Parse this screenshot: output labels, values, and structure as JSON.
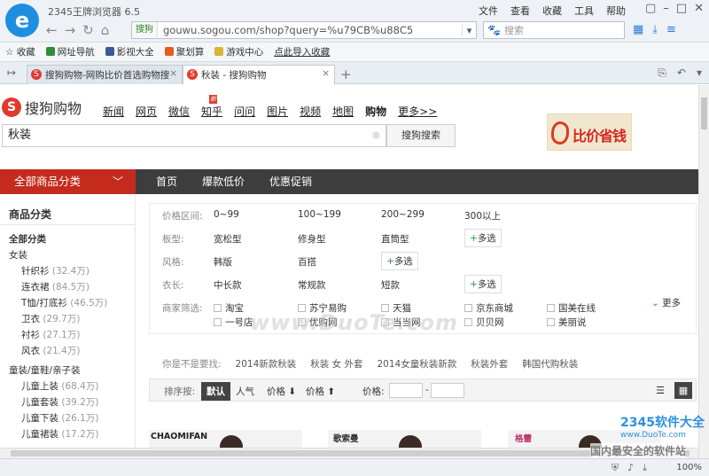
{
  "browser": {
    "title": "2345王牌浏览器 6.5",
    "menu": [
      "文件",
      "查看",
      "收藏",
      "工具",
      "帮助"
    ],
    "address": {
      "safe_label": "搜狗",
      "url": "gouwu.sogou.com/shop?query=%u79CB%u88C5"
    },
    "search_placeholder": "搜索",
    "favorites": [
      "收藏",
      "网址导航",
      "影视大全",
      "聚划算",
      "游戏中心",
      "点此导入收藏"
    ],
    "tabs": [
      {
        "label": "搜狗购物-网购比价首选购物搜"
      },
      {
        "label": "秋装 - 搜狗购物"
      }
    ],
    "zoom": "100%"
  },
  "page": {
    "logo_text": "搜狗购物",
    "nav": [
      "新闻",
      "网页",
      "微信",
      "知乎",
      "问问",
      "图片",
      "视频",
      "地图",
      "购物",
      "更多>>"
    ],
    "new_badge": "新",
    "query": "秋装",
    "search_button": "搜狗搜索",
    "ad_text": "比价省钱",
    "category_bar": {
      "all_label": "全部商品分类",
      "links": [
        "首页",
        "爆款低价",
        "优惠促销"
      ]
    },
    "sidebar": {
      "heading": "商品分类",
      "items": [
        {
          "label": "全部分类",
          "count": ""
        },
        {
          "label": "女装",
          "count": ""
        },
        {
          "label": "针织衫",
          "count": "(32.4万)"
        },
        {
          "label": "连衣裙",
          "count": "(84.5万)"
        },
        {
          "label": "T恤/打底衫",
          "count": "(46.5万)"
        },
        {
          "label": "卫衣",
          "count": "(29.7万)"
        },
        {
          "label": "衬衫",
          "count": "(27.1万)"
        },
        {
          "label": "风衣",
          "count": "(21.4万)"
        },
        {
          "label": "童装/童鞋/亲子装",
          "count": ""
        },
        {
          "label": "儿童上装",
          "count": "(68.4万)"
        },
        {
          "label": "儿童套装",
          "count": "(39.2万)"
        },
        {
          "label": "儿童下装",
          "count": "(26.1万)"
        },
        {
          "label": "儿童裙装",
          "count": "(17.2万)"
        }
      ]
    },
    "filters": {
      "price": {
        "label": "价格区间:",
        "options": [
          "0~99",
          "100~199",
          "200~299",
          "300以上"
        ]
      },
      "fit": {
        "label": "板型:",
        "options": [
          "宽松型",
          "修身型",
          "直筒型"
        ]
      },
      "style": {
        "label": "风格:",
        "options": [
          "韩版",
          "百搭"
        ]
      },
      "length": {
        "label": "衣长:",
        "options": [
          "中长款",
          "常规款",
          "短款"
        ]
      },
      "merchant": {
        "label": "商家筛选:",
        "options": [
          "淘宝",
          "苏宁易购",
          "天猫",
          "京东商城",
          "国美在线",
          "一号店",
          "优购网",
          "当当网",
          "贝贝网",
          "美丽说"
        ]
      },
      "multi_label": "多选",
      "more_label": "更多"
    },
    "suggest": {
      "label": "你是不是要找:",
      "items": [
        "2014新款秋装",
        "秋装 女 外套",
        "2014女童秋装新款",
        "秋装外套",
        "韩国代购秋装"
      ]
    },
    "sort": {
      "label": "排序按:",
      "default_label": "默认",
      "options": [
        "人气",
        "价格 ⬇",
        "价格 ⬆"
      ],
      "price_label": "价格:",
      "dash": "-"
    },
    "products": [
      {
        "brand": "CHAOMIFAN"
      },
      {
        "brand": "歌索曼"
      },
      {
        "brand": "格蕾"
      }
    ]
  },
  "watermarks": {
    "duote": "www.DuoTe.com",
    "brand": "2345软件大全",
    "brand_url": "www.DuoTe.com",
    "tag": "国内最安全的软件站"
  }
}
